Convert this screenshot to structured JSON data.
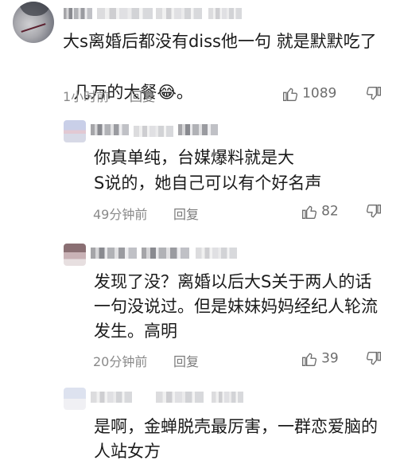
{
  "comments": [
    {
      "text_line1": "大s离婚后都没有diss他一句 就是默默吃了",
      "text_line2": "几万的大餐",
      "emoji": "😂",
      "period": "。",
      "time": "1小时前",
      "reply_label": "回复",
      "likes": "1089"
    },
    {
      "text_line1": "你真单纯，台媒爆料就是大",
      "text_line2": "S说的，她自己可以有个好名声",
      "time": "49分钟前",
      "reply_label": "回复",
      "likes": "82"
    },
    {
      "text_line1": "发现了没？离婚以后大S关于两人的话",
      "text_line2": "一句没说过。但是妹妹妈妈经纪人轮流",
      "text_line3": "发生。高明",
      "time": "20分钟前",
      "reply_label": "回复",
      "likes": "39"
    },
    {
      "text_line1": "是啊，金蝉脱壳最厉害，一群恋爱脑的",
      "text_line2": "人站女方"
    }
  ],
  "icons": {
    "like": "thumbs-up-icon",
    "dislike": "thumbs-down-icon"
  },
  "colors": {
    "text": "#1b1b1b",
    "meta": "#8a8a8a",
    "icon": "#6d6d6d"
  }
}
